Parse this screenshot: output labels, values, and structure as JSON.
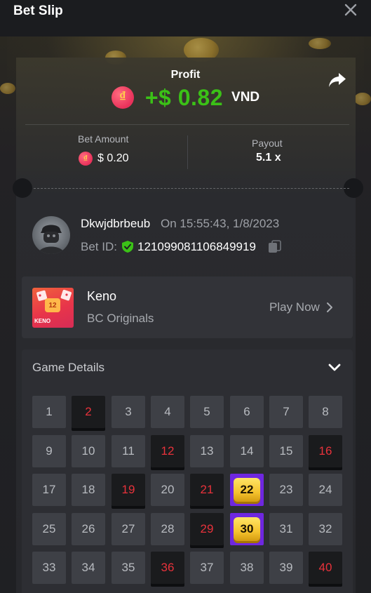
{
  "header": {
    "title": "Bet Slip",
    "close_icon": "close-icon"
  },
  "summary": {
    "profit_label": "Profit",
    "profit_value": "+$ 0.82",
    "profit_currency": "VND",
    "currency_symbol": "₫",
    "bet_amount_label": "Bet Amount",
    "bet_amount_value": "$ 0.20",
    "payout_label": "Payout",
    "payout_value": "5.1 x"
  },
  "bet_info": {
    "username": "Dkwjdbrbeub",
    "time": "On 15:55:43, 1/8/2023",
    "bet_id_label": "Bet ID:",
    "bet_id_value": "121099081106849919"
  },
  "game": {
    "name": "Keno",
    "provider": "BC Originals",
    "play_label": "Play Now",
    "thumb_label": "KENO",
    "thumb_number": "12"
  },
  "details": {
    "title": "Game Details",
    "numbers": [
      1,
      2,
      3,
      4,
      5,
      6,
      7,
      8,
      9,
      10,
      11,
      12,
      13,
      14,
      15,
      16,
      17,
      18,
      19,
      20,
      21,
      22,
      23,
      24,
      25,
      26,
      27,
      28,
      29,
      30,
      31,
      32,
      33,
      34,
      35,
      36,
      37,
      38,
      39,
      40
    ],
    "picked": [
      2,
      12,
      16,
      19,
      21,
      29,
      36,
      40
    ],
    "hits": [
      22,
      30
    ]
  },
  "colors": {
    "profit_green": "#3bc117",
    "pick_red": "#e8323b",
    "hit_purple": "#6f27e0",
    "hit_gold": "#f5c32e"
  }
}
